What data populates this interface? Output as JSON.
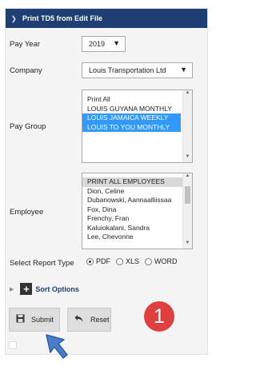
{
  "header": {
    "title": "Print TD5 from Edit File"
  },
  "pay_year": {
    "label": "Pay Year",
    "value": "2019"
  },
  "company": {
    "label": "Company",
    "value": "Louis Transportation Ltd"
  },
  "pay_group": {
    "label": "Pay Group",
    "options": [
      {
        "text": "Print All",
        "selected": false
      },
      {
        "text": "LOUIS GUYANA MONTHLY",
        "selected": false
      },
      {
        "text": "LOUIS JAMAICA WEEKLY",
        "selected": true
      },
      {
        "text": "LOUIS TO YOU MONTHLY",
        "selected": true
      }
    ]
  },
  "employee": {
    "label": "Employee",
    "options": [
      "PRINT ALL EMPLOYEES",
      "Dion, Celine",
      "Dubanowski, Aannaalliissaa",
      "Fox, Dina",
      "Frenchy, Fran",
      "Kaluiokalani, Sandra",
      "Lee, Chevonne"
    ]
  },
  "report_type": {
    "label": "Select Report Type",
    "options": [
      "PDF",
      "XLS",
      "WORD"
    ],
    "selected": "PDF"
  },
  "sort_options": {
    "label": "Sort Options"
  },
  "buttons": {
    "submit": "Submit",
    "reset": "Reset"
  },
  "step_badge": "1",
  "icons": {
    "header": "chevron-right-icon",
    "dropdown": "caret-down-icon",
    "sort": "plus-box-icon",
    "submit": "floppy-disk-icon",
    "reset": "undo-arrow-icon"
  }
}
